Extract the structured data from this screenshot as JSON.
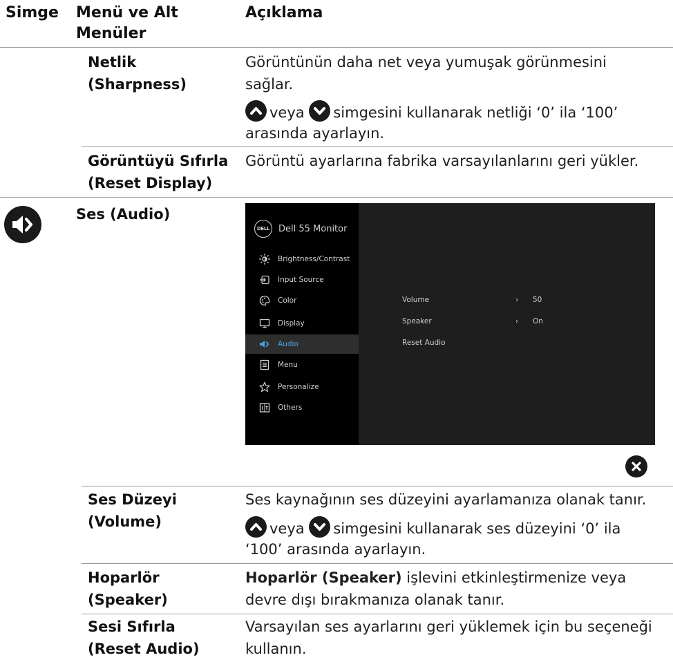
{
  "header": {
    "col_icon": "Simge",
    "col_menu_line1": "Menü ve Alt",
    "col_menu_line2": "Menüler",
    "col_desc": "Açıklama"
  },
  "rows": {
    "sharpness": {
      "label_line1": "Netlik",
      "label_line2": "(Sharpness)",
      "desc_line1": "Görüntünün daha net veya yumuşak görünmesini",
      "desc_line2": "sağlar.",
      "adjust_line1_mid": "veya",
      "adjust_line1_end": "simgesini kullanarak netliği ‘0’ ila ‘100’",
      "adjust_line2": "arasında ayarlayın."
    },
    "reset_display": {
      "label_line1": "Görüntüyü Sıfırla",
      "label_line2": "(Reset Display)",
      "desc_line1": "Görüntü ayarlarına fabrika varsayılanlarını geri yükler."
    },
    "audio": {
      "label": "Ses (Audio)",
      "icon": "speaker-icon"
    },
    "volume": {
      "label_line1": "Ses Düzeyi",
      "label_line2": "(Volume)",
      "desc_line1": "Ses kaynağının ses düzeyini ayarlamanıza olanak tanır.",
      "adjust_line1_mid": "veya",
      "adjust_line1_end": "simgesini kullanarak ses düzeyini ‘0’ ila",
      "adjust_line2": "‘100’ arasında ayarlayın."
    },
    "speaker": {
      "label_line1": "Hoparlör",
      "label_line2": "(Speaker)",
      "desc_line1_bold": "Hoparlör (Speaker)",
      "desc_line1_rest": " işlevini etkinleştirmenize veya",
      "desc_line2": "devre dışı bırakmanıza olanak tanır."
    },
    "reset_audio": {
      "label_line1": "Sesi Sıfırla",
      "label_line2": "(Reset Audio)",
      "desc_line1": "Varsayılan ses ayarlarını geri yüklemek için bu seçeneği",
      "desc_line2": "kullanın."
    }
  },
  "osd": {
    "logo_text": "DELL",
    "title": "Dell 55 Monitor",
    "menu": [
      {
        "label": "Brightness/Contrast",
        "icon": "brightness-icon"
      },
      {
        "label": "Input Source",
        "icon": "input-source-icon"
      },
      {
        "label": "Color",
        "icon": "color-palette-icon"
      },
      {
        "label": "Display",
        "icon": "display-icon"
      },
      {
        "label": "Audio",
        "icon": "audio-icon",
        "active": true
      },
      {
        "label": "Menu",
        "icon": "menu-icon"
      },
      {
        "label": "Personalize",
        "icon": "star-icon"
      },
      {
        "label": "Others",
        "icon": "others-icon"
      }
    ],
    "audio_rows": [
      {
        "name": "Volume",
        "arrow": "›",
        "value": "50"
      },
      {
        "name": "Speaker",
        "arrow": "›",
        "value": "On"
      },
      {
        "name": "Reset Audio",
        "arrow": "",
        "value": ""
      }
    ],
    "accent_color": "#4aa3df"
  }
}
